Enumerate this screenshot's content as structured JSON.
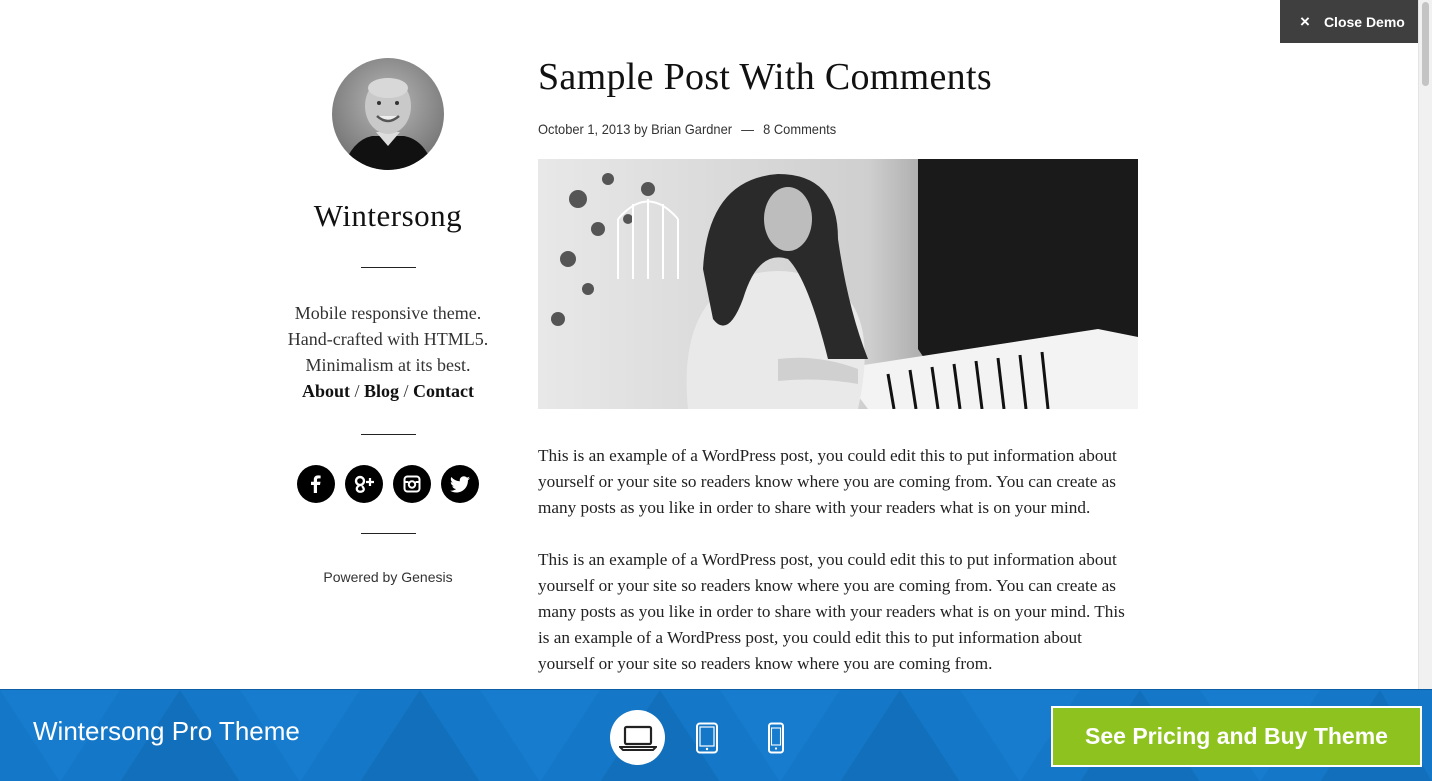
{
  "demo_bar": {
    "close_label": "Close Demo",
    "close_icon": "×"
  },
  "sidebar": {
    "site_title": "Wintersong",
    "description_lines": [
      "Mobile responsive theme.",
      "Hand-crafted with HTML5.",
      "Minimalism at its best."
    ],
    "nav": [
      {
        "label": "About"
      },
      {
        "label": "Blog"
      },
      {
        "label": "Contact"
      }
    ],
    "nav_separator": "/",
    "social": [
      "facebook-icon",
      "google-plus-icon",
      "instagram-icon",
      "twitter-icon"
    ],
    "powered_by": "Powered by Genesis"
  },
  "post": {
    "title": "Sample Post With Comments",
    "date": "October 1, 2013",
    "by": "by",
    "author": "Brian Gardner",
    "separator": "—",
    "comments": "8 Comments",
    "paragraphs": [
      "This is an example of a WordPress post, you could edit this to put information about yourself or your site so readers know where you are coming from. You can create as many posts as you like in order to share with your readers what is on your mind.",
      "This is an example of a WordPress post, you could edit this to put information about yourself or your site so readers know where you are coming from. You can create as many posts as you like in order to share with your readers what is on your mind. This is an example of a WordPress post, you could edit this to put information about yourself or your site so readers know where you are coming from."
    ]
  },
  "bottom_bar": {
    "theme_name": "Wintersong Pro Theme",
    "devices": [
      "laptop-icon",
      "tablet-icon",
      "phone-icon"
    ],
    "active_device": "laptop-icon",
    "buy_label": "See Pricing and Buy Theme",
    "colors": {
      "bar": "#1477c7",
      "buy": "#8dc21f"
    }
  }
}
